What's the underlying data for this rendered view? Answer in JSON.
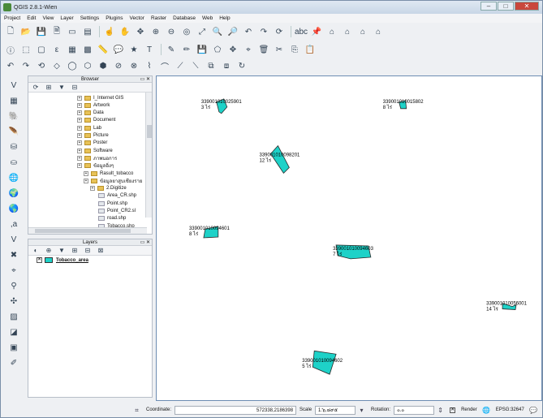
{
  "window": {
    "title": "QGIS 2.8.1-Wien"
  },
  "menu": [
    "Project",
    "Edit",
    "View",
    "Layer",
    "Settings",
    "Plugins",
    "Vector",
    "Raster",
    "Database",
    "Web",
    "Help"
  ],
  "browser": {
    "title": "Browser",
    "items": [
      {
        "label": "I_Internet GIS",
        "kind": "folder",
        "indent": 0
      },
      {
        "label": "Artwork",
        "kind": "folder",
        "indent": 0
      },
      {
        "label": "Data",
        "kind": "folder",
        "indent": 0
      },
      {
        "label": "Document",
        "kind": "folder",
        "indent": 0
      },
      {
        "label": "Lab",
        "kind": "folder",
        "indent": 0
      },
      {
        "label": "Picture",
        "kind": "folder",
        "indent": 0
      },
      {
        "label": "Poster",
        "kind": "folder",
        "indent": 0
      },
      {
        "label": "Software",
        "kind": "folder",
        "indent": 0
      },
      {
        "label": "ภาพนอการ",
        "kind": "folder",
        "indent": 0
      },
      {
        "label": "ข้อมูลอิ่งๆ",
        "kind": "folder",
        "indent": 0
      },
      {
        "label": "Rasult_tobacco",
        "kind": "folder",
        "indent": 1
      },
      {
        "label": "ข้อมูลยาสูบเชียงราย",
        "kind": "folder",
        "indent": 1
      },
      {
        "label": "2.Digitize",
        "kind": "folder",
        "indent": 2
      },
      {
        "label": "Area_CR.shp",
        "kind": "file",
        "indent": 3
      },
      {
        "label": "Point.shp",
        "kind": "file",
        "indent": 3
      },
      {
        "label": "Point_CR2.sl",
        "kind": "file",
        "indent": 3
      },
      {
        "label": "road.shp",
        "kind": "file",
        "indent": 3
      },
      {
        "label": "Tobacco.shp",
        "kind": "file",
        "indent": 3
      }
    ]
  },
  "layers": {
    "title": "Layers",
    "items": [
      {
        "name": "Tobacco_area",
        "checked": "✕",
        "color": "#1ed2c8"
      }
    ]
  },
  "map": {
    "fill": "#1ed2c8",
    "features": [
      {
        "id": "339001010025901",
        "area": "3 ไร่"
      },
      {
        "id": "339001010015802",
        "area": "8 ไร่"
      },
      {
        "id": "339001010098201",
        "area": "12 ไร่"
      },
      {
        "id": "339001010094601",
        "area": "8 ไร่"
      },
      {
        "id": "339001010094603",
        "area": "7 ไร่"
      },
      {
        "id": "339001010056001",
        "area": "14 ไร่"
      },
      {
        "id": "339001010094602",
        "area": "5 ไร่"
      }
    ]
  },
  "status": {
    "coordinate_label": "Coordinate:",
    "coordinate": "572338,2186398",
    "scale_label": "Scale",
    "scale": "1:๖,๘๙๕",
    "rotation_label": "Rotation:",
    "rotation": "๐.๐",
    "render_label": "Render",
    "render_checked": "✕",
    "crs": "EPSG:32647"
  }
}
